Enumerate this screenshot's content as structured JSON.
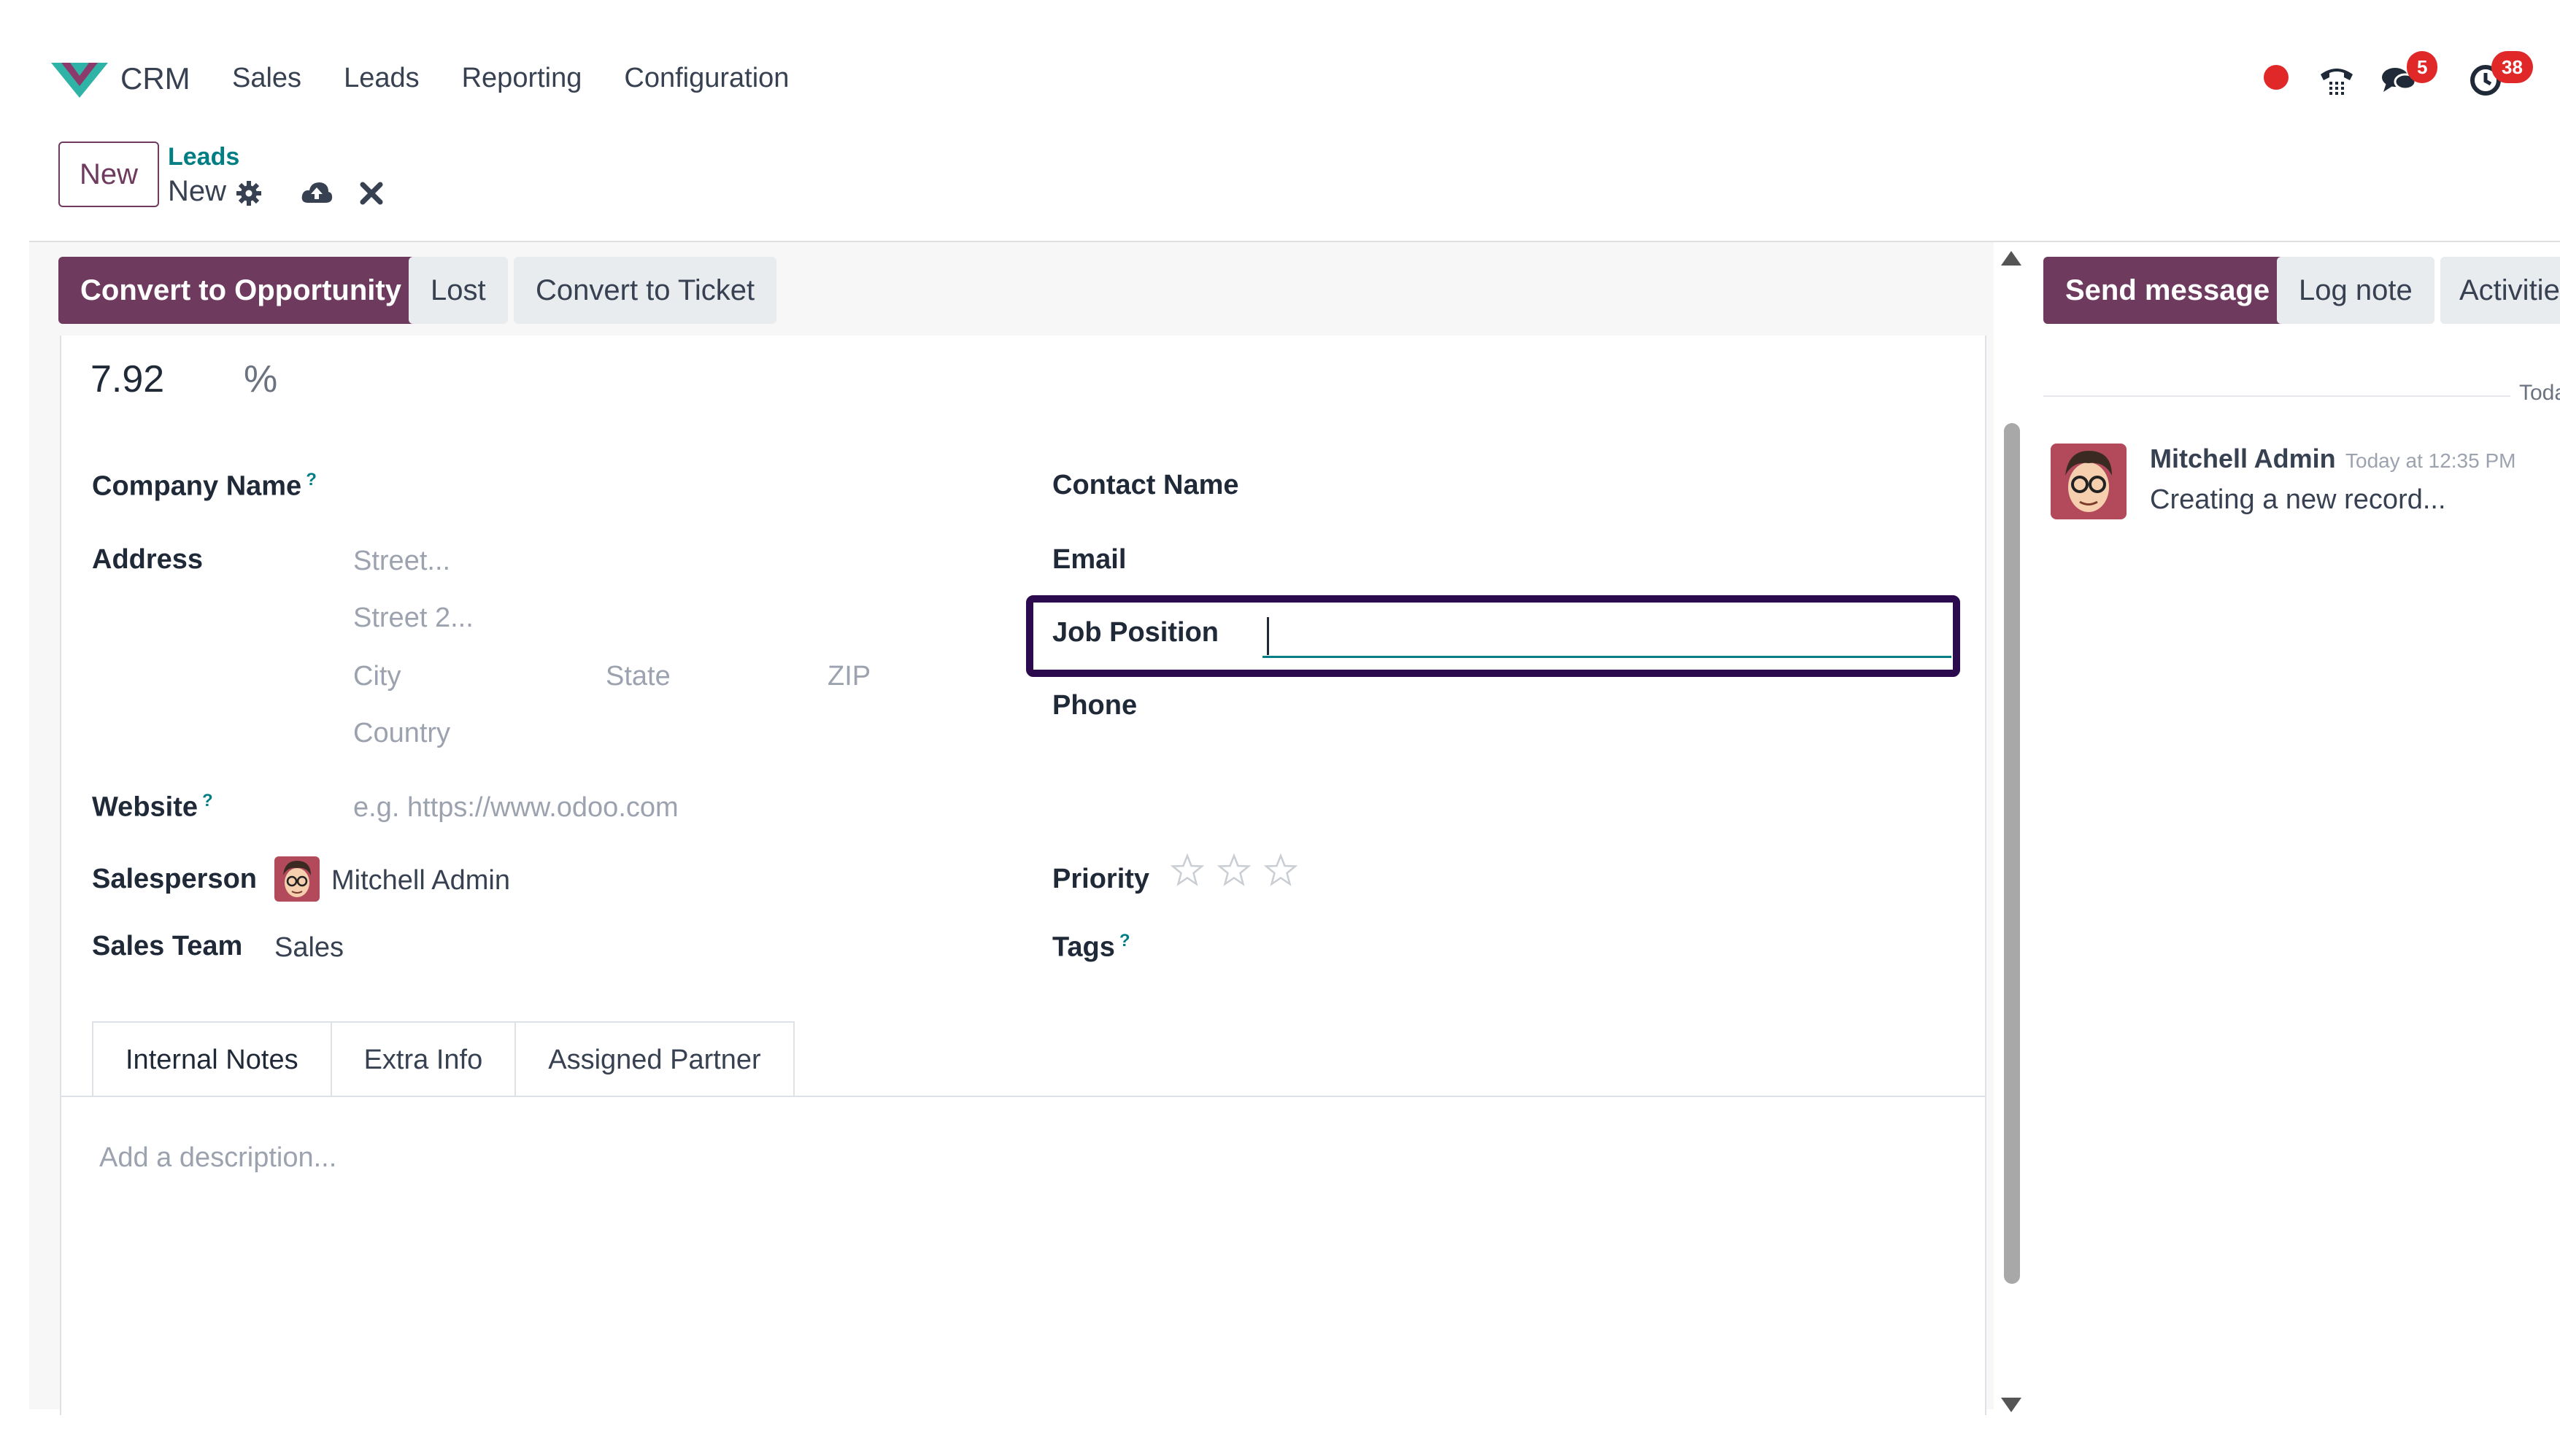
{
  "navbar": {
    "app_name": "CRM",
    "menu": [
      "Sales",
      "Leads",
      "Reporting",
      "Configuration"
    ],
    "messages_count": "5",
    "activities_count": "38"
  },
  "breadcrumb": {
    "new_button": "New",
    "parent": "Leads",
    "current": "New"
  },
  "statusbar": {
    "convert_opportunity": "Convert to Opportunity",
    "lost": "Lost",
    "convert_ticket": "Convert to Ticket"
  },
  "form": {
    "probability": "7.92",
    "probability_unit": "%",
    "company_name_label": "Company Name",
    "help_mark": "?",
    "address_label": "Address",
    "street_placeholder": "Street...",
    "street2_placeholder": "Street 2...",
    "city_placeholder": "City",
    "state_placeholder": "State",
    "zip_placeholder": "ZIP",
    "country_placeholder": "Country",
    "website_label": "Website",
    "website_placeholder": "e.g. https://www.odoo.com",
    "salesperson_label": "Salesperson",
    "salesperson_value": "Mitchell Admin",
    "sales_team_label": "Sales Team",
    "sales_team_value": "Sales",
    "contact_name_label": "Contact Name",
    "email_label": "Email",
    "job_position_label": "Job Position",
    "job_position_value": "",
    "phone_label": "Phone",
    "priority_label": "Priority",
    "priority_stars": 0,
    "priority_max": 3,
    "tags_label": "Tags"
  },
  "tabs": [
    "Internal Notes",
    "Extra Info",
    "Assigned Partner"
  ],
  "notes": {
    "placeholder": "Add a description..."
  },
  "chatter": {
    "send_message": "Send message",
    "log_note": "Log note",
    "activities": "Activitie",
    "date_separator": "Toda",
    "messages": [
      {
        "author": "Mitchell Admin",
        "date": "Today at 12:35 PM",
        "body": "Creating a new record..."
      }
    ]
  },
  "colors": {
    "primary": "#6e3a5d",
    "link": "#017e84",
    "badge": "#e02828",
    "highlight": "#2b0b4d"
  }
}
